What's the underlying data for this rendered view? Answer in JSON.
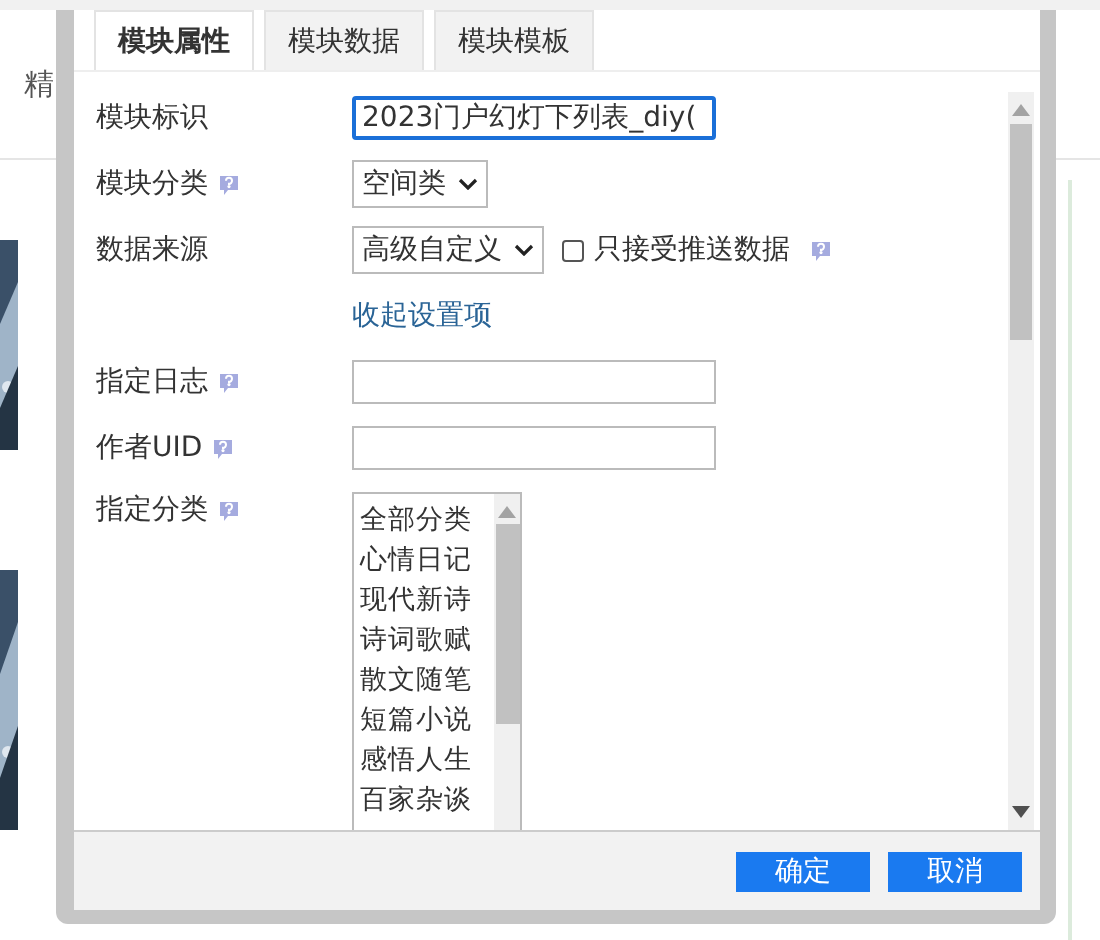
{
  "background": {
    "tab_text": "精"
  },
  "dialog": {
    "tabs": [
      {
        "label": "模块属性",
        "selected": true
      },
      {
        "label": "模块数据",
        "selected": false
      },
      {
        "label": "模块模板",
        "selected": false
      }
    ],
    "fields": [
      {
        "kind": "text",
        "label": "模块标识",
        "value": "2023门户幻灯下列表_diy(",
        "focused": true,
        "help": false
      },
      {
        "kind": "select",
        "label": "模块分类",
        "value": "空间类",
        "help": true
      },
      {
        "kind": "select",
        "label": "数据来源",
        "value": "高级自定义",
        "help": false,
        "checkbox": {
          "label": "只接受推送数据",
          "checked": false,
          "help": true
        }
      },
      {
        "kind": "link",
        "label": "收起设置项"
      },
      {
        "kind": "text",
        "label": "指定日志",
        "focused": false,
        "help": true
      },
      {
        "kind": "text",
        "label": "作者UID",
        "focused": false,
        "help": true
      },
      {
        "kind": "listbox",
        "label": "指定分类",
        "help": true,
        "options": [
          {
            "label": "全部分类",
            "selected": false
          },
          {
            "label": "心情日记",
            "selected": false
          },
          {
            "label": "现代新诗",
            "selected": false
          },
          {
            "label": "诗词歌赋",
            "selected": false
          },
          {
            "label": "散文随笔",
            "selected": false
          },
          {
            "label": "短篇小说",
            "selected": false
          },
          {
            "label": "感悟人生",
            "selected": false
          },
          {
            "label": "百家杂谈",
            "selected": false
          }
        ]
      }
    ],
    "buttons": [
      {
        "label": "确定",
        "kind": "primary"
      },
      {
        "label": "取消",
        "kind": "primary"
      }
    ]
  }
}
